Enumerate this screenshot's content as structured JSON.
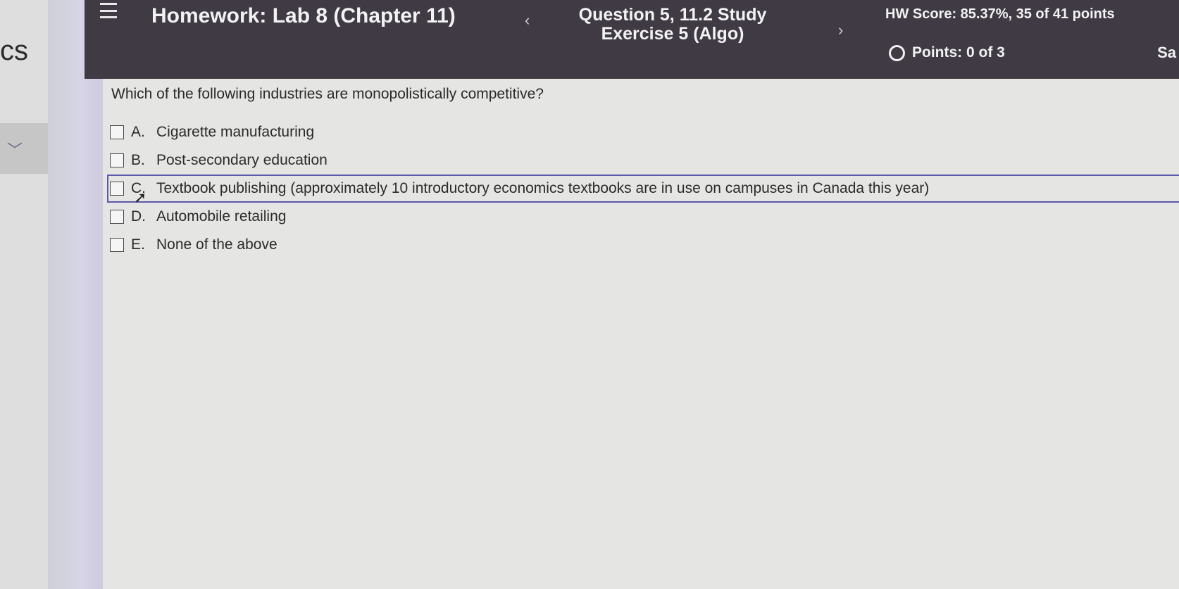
{
  "sidebar": {
    "logo_text": "cs",
    "expand_glyph": "﹀"
  },
  "header": {
    "menu_icon": "hamburger-menu-icon",
    "title": "Homework:  Lab 8 (Chapter 11)",
    "prev_glyph": "‹",
    "next_glyph": "›",
    "question_title": "Question 5, 11.2 Study Exercise 5 (Algo)",
    "hw_score": "HW Score: 85.37%, 35 of 41 points",
    "points": "Points: 0 of 3",
    "save_partial": "Sa"
  },
  "question": {
    "text": "Which of the following industries are monopolistically competitive?",
    "options": [
      {
        "letter": "A.",
        "text": "Cigarette manufacturing",
        "checked": false
      },
      {
        "letter": "B.",
        "text": "Post-secondary education",
        "checked": false
      },
      {
        "letter": "C.",
        "text": "Textbook publishing (approximately 10 introductory economics textbooks are in use on campuses in Canada this year)",
        "checked": false
      },
      {
        "letter": "D.",
        "text": "Automobile retailing",
        "checked": false
      },
      {
        "letter": "E.",
        "text": "None of the above",
        "checked": false
      }
    ]
  },
  "colors": {
    "header_bg": "#3f3a44",
    "focus_border": "#5a5aa8",
    "content_bg": "#e5e5e3"
  }
}
